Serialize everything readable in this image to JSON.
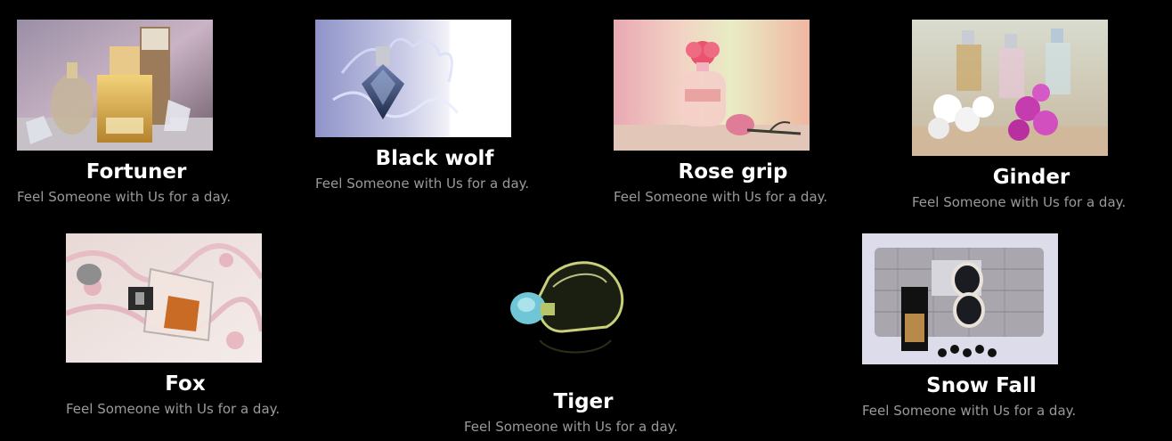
{
  "products": [
    {
      "title": "Fortuner",
      "desc": "Feel Someone with Us for a day.",
      "image": "perfume-bottles-icon"
    },
    {
      "title": "Black wolf",
      "desc": "Feel Someone with Us for a day.",
      "image": "perfume-splash-icon"
    },
    {
      "title": "Rose grip",
      "desc": "Feel Someone with Us for a day.",
      "image": "rose-perfume-icon"
    },
    {
      "title": "Ginder",
      "desc": "Feel Someone with Us for a day.",
      "image": "flower-perfume-icon"
    },
    {
      "title": "Fox",
      "desc": "Feel Someone with Us for a day.",
      "image": "perfume-on-fabric-icon"
    },
    {
      "title": "Tiger",
      "desc": "Feel Someone with Us for a day.",
      "image": "heart-bottle-icon"
    },
    {
      "title": "Snow Fall",
      "desc": "Feel Someone with Us for a day.",
      "image": "clutch-bag-icon"
    }
  ],
  "colors": {
    "background": "#000000",
    "title": "#ffffff",
    "description": "#9a9a9a"
  }
}
